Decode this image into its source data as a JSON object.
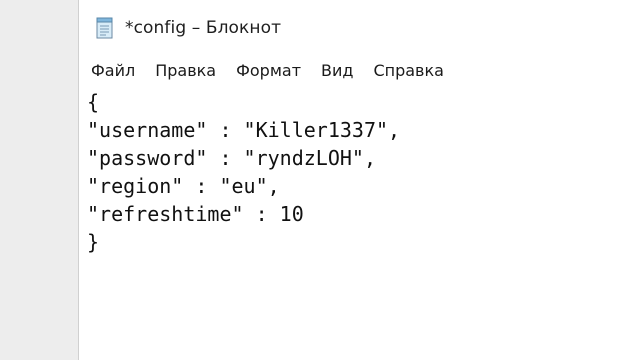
{
  "window": {
    "title": "*config – Блокнот",
    "app_icon": "notepad-icon"
  },
  "menu": [
    {
      "label": "Файл"
    },
    {
      "label": "Правка"
    },
    {
      "label": "Формат"
    },
    {
      "label": "Вид"
    },
    {
      "label": "Справка"
    }
  ],
  "editor": {
    "lines": [
      "{",
      "\"username\" : \"Killer1337\",",
      "\"password\" : \"ryndzLOH\",",
      "\"region\" : \"eu\",",
      "\"refreshtime\" : 10",
      "}"
    ]
  }
}
